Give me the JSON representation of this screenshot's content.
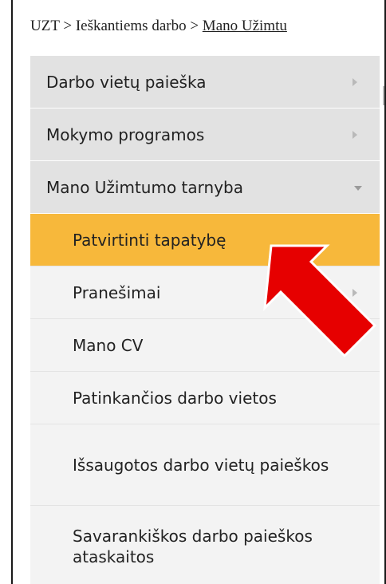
{
  "breadcrumb": {
    "root": "UZT",
    "sep1": " > ",
    "section": "Ieškantiems darbo",
    "sep2": " > ",
    "current": "Mano Užimtu"
  },
  "menu": {
    "items": [
      {
        "label": "Darbo vietų paieška",
        "expander": "chevron-right-icon"
      },
      {
        "label": "Mokymo programos",
        "expander": "chevron-right-icon"
      },
      {
        "label": "Mano Užimtumo tarnyba",
        "expander": "chevron-down-icon"
      }
    ],
    "subitems": [
      {
        "label": "Patvirtinti tapatybę",
        "active": true
      },
      {
        "label": "Pranešimai",
        "expander": "chevron-right-icon"
      },
      {
        "label": "Mano CV"
      },
      {
        "label": "Patinkančios darbo vietos"
      },
      {
        "label": "Išsaugotos darbo vietų paieškos"
      },
      {
        "label": "Savarankiškos darbo paieškos ataskaitos"
      }
    ]
  },
  "colors": {
    "active_bg": "#f7b83b",
    "top_item_bg": "#e2e2e2",
    "sub_item_bg": "#f3f3f3",
    "pointer_arrow": "#e60000"
  },
  "annotation": {
    "icon": "red-arrow-icon"
  }
}
